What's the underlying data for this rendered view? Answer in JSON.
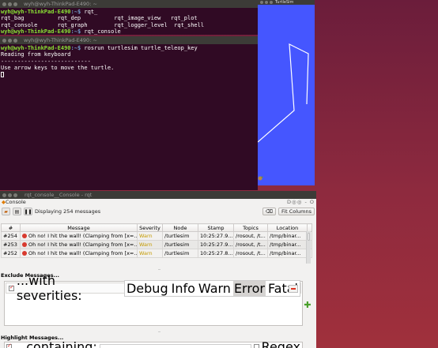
{
  "terminal1": {
    "title": "wyh@wyh-ThinkPad-E490: ~",
    "prompt": "wyh@wyh-ThinkPad-E490",
    "path": ":~$",
    "line1_cmd": " rqt_",
    "completions_row1": "rqt_bag          rqt_dep          rqt_image_view   rqt_plot",
    "completions_row2": "rqt_console      rqt_graph        rqt_logger_level  rqt_shell",
    "line_last_cmd": " rqt_console"
  },
  "terminal2": {
    "title": "wyh@wyh-ThinkPad-E490: ~",
    "prompt": "wyh@wyh-ThinkPad-E490",
    "path": ":~$",
    "cmd": " rosrun turtlesim turtle_teleop_key",
    "out1": "Reading from keyboard",
    "out2": "---------------------------",
    "out3": "Use arrow keys to move the turtle."
  },
  "turtlesim": {
    "title": "TurtleSim",
    "background": "#4556ff",
    "path_color": "#ffffff"
  },
  "rqt": {
    "window_title": "rqt_console__Console - rqt",
    "menu_title": "Console",
    "menu_controls": "D◎◎ - O",
    "status": "Displaying 254 messages",
    "clear_label": "⌫",
    "fit_columns_label": "Fit Columns",
    "columns": [
      "#",
      "Message",
      "Severity",
      "Node",
      "Stamp",
      "Topics",
      "Location"
    ],
    "rows": [
      {
        "num": "#254",
        "message": "Oh no! I hit the wall! (Clamping from [x=...",
        "severity": "Warn",
        "node": "/turtlesim",
        "stamp": "10:25:27.9...",
        "topics": "/rosout, /t...",
        "location": "/tmp/binar..."
      },
      {
        "num": "#253",
        "message": "Oh no! I hit the wall! (Clamping from [x=...",
        "severity": "Warn",
        "node": "/turtlesim",
        "stamp": "10:25:27.9...",
        "topics": "/rosout, /t...",
        "location": "/tmp/binar..."
      },
      {
        "num": "#252",
        "message": "Oh no! I hit the wall! (Clamping from [x=...",
        "severity": "Warn",
        "node": "/turtlesim",
        "stamp": "10:25:27.8...",
        "topics": "/rosout, /t...",
        "location": "/tmp/binar..."
      }
    ],
    "exclude_title": "Exclude Messages...",
    "exclude_label": "...with severities:",
    "severities": [
      "Debug",
      "Info",
      "Warn",
      "Error",
      "Fatal"
    ],
    "highlight_title": "Highlight Messages...",
    "highlight_label": "...containing:",
    "regex_label": "Regex",
    "warn_color": "#c49a00",
    "error_color": "#d83a2e"
  }
}
